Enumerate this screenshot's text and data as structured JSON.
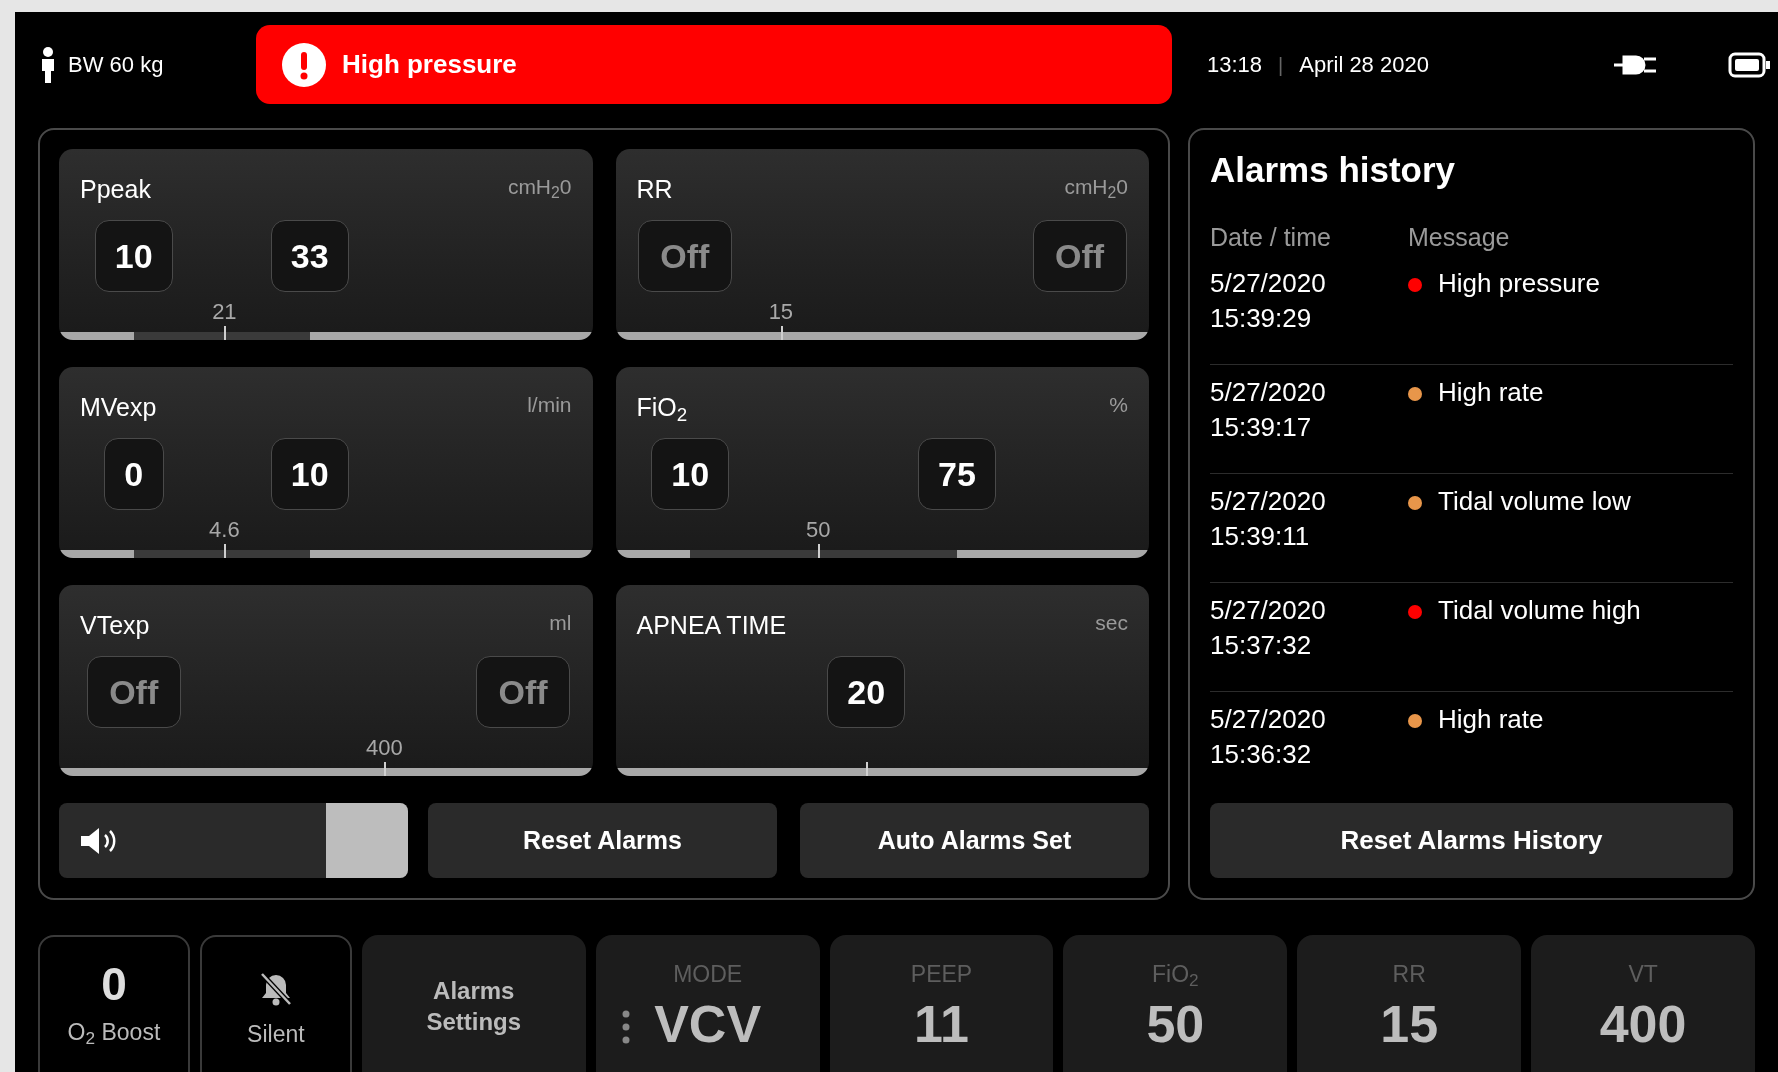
{
  "top_bar": {
    "weight": "BW 60 kg",
    "alert": {
      "message": "High pressure"
    },
    "time": "13:18",
    "separator": "|",
    "date": "April 28 2020"
  },
  "alarm_cards": [
    {
      "title": "Ppeak",
      "unit": "cmH$_{2}$0",
      "limits": [
        {
          "value": "10",
          "off": false,
          "level": 0.14
        },
        {
          "value": "33",
          "off": false,
          "level": 0.47
        }
      ],
      "reading": "21",
      "marker": {
        "level": 0.31
      }
    },
    {
      "title": "RR",
      "unit": "cmH$_{2}$0",
      "limits": [
        {
          "value": "Off",
          "off": true,
          "level": 0.13
        },
        {
          "value": "Off",
          "off": true,
          "level": 0.87
        }
      ],
      "reading": "15",
      "marker": {
        "level": 0.31
      }
    },
    {
      "title": "MVexp",
      "unit": "l/min",
      "limits": [
        {
          "value": "0",
          "off": false,
          "level": 0.14
        },
        {
          "value": "10",
          "off": false,
          "level": 0.47
        }
      ],
      "reading": "4.6",
      "marker": {
        "level": 0.31
      }
    },
    {
      "title": "FiO$_{2}$",
      "unit": "%",
      "limits": [
        {
          "value": "10",
          "off": false,
          "level": 0.14
        },
        {
          "value": "75",
          "off": false,
          "level": 0.64
        }
      ],
      "reading": "50",
      "marker": {
        "level": 0.38
      }
    },
    {
      "title": "VTexp",
      "unit": "ml",
      "limits": [
        {
          "value": "Off",
          "off": true,
          "level": 0.14
        },
        {
          "value": "Off",
          "off": true,
          "level": 0.87
        }
      ],
      "reading": "400",
      "marker": {
        "level": 0.61
      }
    },
    {
      "title": "APNEA TIME",
      "unit": "sec",
      "limits": [
        {
          "value": "20",
          "off": false,
          "level": 0.47
        }
      ],
      "marker": {
        "level": 0.47
      }
    }
  ],
  "volume_slider": {
    "level": 1
  },
  "buttons": [
    "Reset Alarms",
    "Auto Alarms Set"
  ],
  "alarms_history": {
    "title": "Alarms history",
    "columns": [
      "Date / time",
      "Message"
    ],
    "rows": [
      {
        "date": "5/27/2020",
        "time": "15:39:29",
        "message": "High pressure",
        "color": "#ff0000"
      },
      {
        "date": "5/27/2020",
        "time": "15:39:17",
        "message": "High rate",
        "color": "#e8964a"
      },
      {
        "date": "5/27/2020",
        "time": "15:39:11",
        "message": "Tidal volume low",
        "color": "#e8964a"
      },
      {
        "date": "5/27/2020",
        "time": "15:37:32",
        "message": "Tidal volume high",
        "color": "#ff0000"
      },
      {
        "date": "5/27/2020",
        "time": "15:36:32",
        "message": "High rate",
        "color": "#e8964a"
      }
    ],
    "reset_button": "Reset Alarms History"
  },
  "bottom_tiles": [
    {
      "kind": "value",
      "value": "0",
      "label": "O$_{2}$ Boost"
    },
    {
      "kind": "icon",
      "label": "Silent"
    },
    {
      "kind": "text",
      "label": "Alarms Settings"
    },
    {
      "kind": "setting",
      "label": "MODE",
      "value": "VCV",
      "menu": true
    },
    {
      "kind": "setting",
      "label": "PEEP",
      "value": "11",
      "menu": false
    },
    {
      "kind": "setting",
      "label": "FiO$_{2}$",
      "value": "50",
      "menu": false
    },
    {
      "kind": "setting",
      "label": "RR",
      "value": "15",
      "menu": false
    },
    {
      "kind": "setting",
      "label": "VT",
      "value": "400",
      "menu": false
    }
  ]
}
